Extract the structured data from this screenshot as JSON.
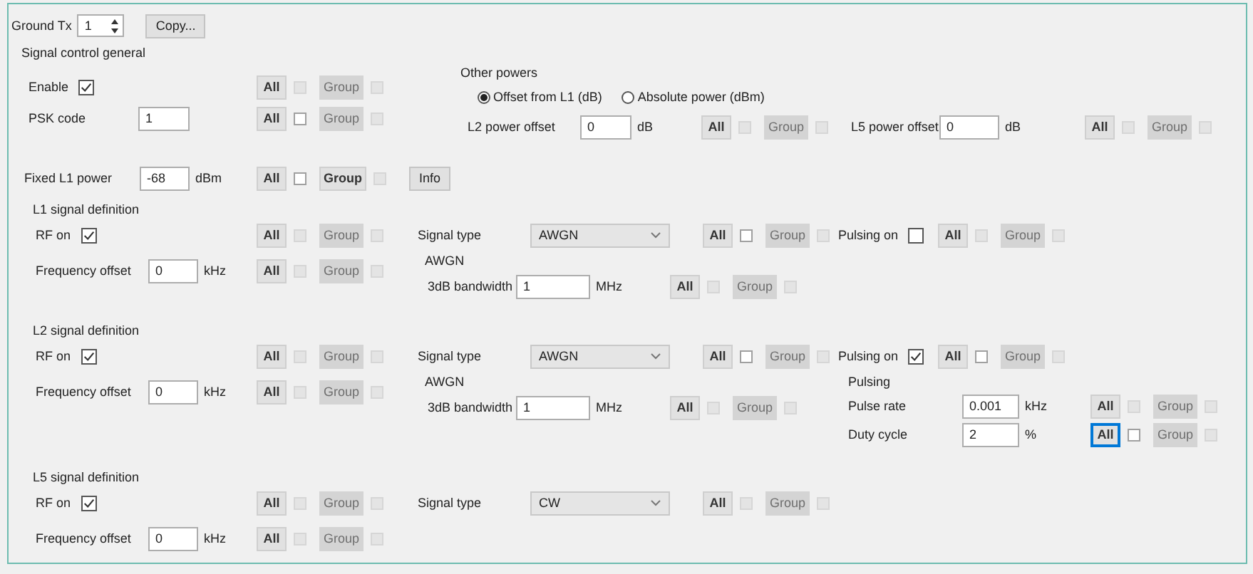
{
  "toolbar": {
    "label": "Ground Tx",
    "spin_value": "1",
    "copy_button": "Copy..."
  },
  "general": {
    "title": "Signal control general",
    "rows": [
      {
        "label": "Enable",
        "kind": "checkbox",
        "checked": true,
        "sync": [
          {
            "label": "All",
            "disabled": false,
            "focused": false,
            "box_disabled": true
          },
          {
            "label": "Group",
            "disabled": true,
            "focused": false,
            "box_disabled": true
          }
        ]
      },
      {
        "label": "PSK code",
        "kind": "field",
        "value": "1",
        "sync": [
          {
            "label": "All",
            "disabled": false,
            "focused": false,
            "box_disabled": false
          },
          {
            "label": "Group",
            "disabled": true,
            "focused": false,
            "box_disabled": true
          }
        ]
      }
    ],
    "other_powers": {
      "title": "Other powers",
      "options": [
        {
          "label": "Offset from L1 (dB)",
          "selected": true
        },
        {
          "label": "Absolute power (dBm)",
          "selected": false
        }
      ],
      "rows": [
        {
          "label": "L2 power offset",
          "kind": "field",
          "value": "0",
          "unit": "dB",
          "sync": [
            {
              "label": "All",
              "disabled": false,
              "focused": false,
              "box_disabled": true
            },
            {
              "label": "Group",
              "disabled": true,
              "focused": false,
              "box_disabled": true
            }
          ]
        },
        {
          "label": "L5 power offset",
          "kind": "field",
          "value": "0",
          "unit": "dB",
          "sync": [
            {
              "label": "All",
              "disabled": false,
              "focused": false,
              "box_disabled": true
            },
            {
              "label": "Group",
              "disabled": true,
              "focused": false,
              "box_disabled": true
            }
          ]
        }
      ]
    },
    "fixed_power": {
      "label": "Fixed L1 power",
      "kind": "field",
      "value": "-68",
      "unit": "dBm",
      "sync": [
        {
          "label": "All",
          "disabled": false,
          "focused": false,
          "box_disabled": false
        },
        {
          "label": "Group",
          "disabled": false,
          "focused": false,
          "box_disabled": true
        }
      ],
      "info_button": "Info"
    }
  },
  "signals": [
    {
      "title": "L1 signal definition",
      "rf": {
        "label": "RF on",
        "kind": "checkbox",
        "checked": true,
        "sync": [
          {
            "label": "All",
            "disabled": false,
            "focused": false,
            "box_disabled": true
          },
          {
            "label": "Group",
            "disabled": true,
            "focused": false,
            "box_disabled": true
          }
        ]
      },
      "frequency": {
        "label": "Frequency offset",
        "kind": "field",
        "value": "0",
        "unit": "kHz",
        "sync": [
          {
            "label": "All",
            "disabled": false,
            "focused": false,
            "box_disabled": true
          },
          {
            "label": "Group",
            "disabled": true,
            "focused": false,
            "box_disabled": true
          }
        ]
      },
      "signal_type": {
        "label": "Signal type",
        "kind": "dropdown",
        "value": "AWGN",
        "sync": [
          {
            "label": "All",
            "disabled": false,
            "focused": false,
            "box_disabled": false
          },
          {
            "label": "Group",
            "disabled": true,
            "focused": false,
            "box_disabled": true
          }
        ]
      },
      "awgn": {
        "title": "AWGN",
        "rows": [
          {
            "label": "3dB bandwidth",
            "kind": "field",
            "value": "1",
            "unit": "MHz",
            "sync": [
              {
                "label": "All",
                "disabled": false,
                "focused": false,
                "box_disabled": true
              },
              {
                "label": "Group",
                "disabled": true,
                "focused": false,
                "box_disabled": true
              }
            ]
          }
        ]
      },
      "pulsing": {
        "label": "Pulsing on",
        "kind": "checkbox",
        "checked": false,
        "sync": [
          {
            "label": "All",
            "disabled": false,
            "focused": false,
            "box_disabled": true
          },
          {
            "label": "Group",
            "disabled": true,
            "focused": false,
            "box_disabled": true
          }
        ]
      }
    },
    {
      "title": "L2 signal definition",
      "rf": {
        "label": "RF on",
        "kind": "checkbox",
        "checked": true,
        "sync": [
          {
            "label": "All",
            "disabled": false,
            "focused": false,
            "box_disabled": true
          },
          {
            "label": "Group",
            "disabled": true,
            "focused": false,
            "box_disabled": true
          }
        ]
      },
      "frequency": {
        "label": "Frequency offset",
        "kind": "field",
        "value": "0",
        "unit": "kHz",
        "sync": [
          {
            "label": "All",
            "disabled": false,
            "focused": false,
            "box_disabled": true
          },
          {
            "label": "Group",
            "disabled": true,
            "focused": false,
            "box_disabled": true
          }
        ]
      },
      "signal_type": {
        "label": "Signal type",
        "kind": "dropdown",
        "value": "AWGN",
        "sync": [
          {
            "label": "All",
            "disabled": false,
            "focused": false,
            "box_disabled": false
          },
          {
            "label": "Group",
            "disabled": true,
            "focused": false,
            "box_disabled": true
          }
        ]
      },
      "awgn": {
        "title": "AWGN",
        "rows": [
          {
            "label": "3dB bandwidth",
            "kind": "field",
            "value": "1",
            "unit": "MHz",
            "sync": [
              {
                "label": "All",
                "disabled": false,
                "focused": false,
                "box_disabled": true
              },
              {
                "label": "Group",
                "disabled": true,
                "focused": false,
                "box_disabled": true
              }
            ]
          }
        ]
      },
      "pulsing": {
        "label": "Pulsing on",
        "kind": "checkbox",
        "checked": true,
        "sync": [
          {
            "label": "All",
            "disabled": false,
            "focused": false,
            "box_disabled": false
          },
          {
            "label": "Group",
            "disabled": true,
            "focused": false,
            "box_disabled": true
          }
        ]
      },
      "pulse": {
        "title": "Pulsing",
        "rows": [
          {
            "label": "Pulse rate",
            "kind": "field",
            "value": "0.001",
            "unit": "kHz",
            "sync": [
              {
                "label": "All",
                "disabled": false,
                "focused": false,
                "box_disabled": true
              },
              {
                "label": "Group",
                "disabled": true,
                "focused": false,
                "box_disabled": true
              }
            ]
          },
          {
            "label": "Duty cycle",
            "kind": "field",
            "value": "2",
            "unit": "%",
            "sync": [
              {
                "label": "All",
                "disabled": false,
                "focused": true,
                "box_disabled": false
              },
              {
                "label": "Group",
                "disabled": true,
                "focused": false,
                "box_disabled": true
              }
            ]
          }
        ]
      }
    },
    {
      "title": "L5 signal definition",
      "rf": {
        "label": "RF on",
        "kind": "checkbox",
        "checked": true,
        "sync": [
          {
            "label": "All",
            "disabled": false,
            "focused": false,
            "box_disabled": true
          },
          {
            "label": "Group",
            "disabled": true,
            "focused": false,
            "box_disabled": true
          }
        ]
      },
      "frequency": {
        "label": "Frequency offset",
        "kind": "field",
        "value": "0",
        "unit": "kHz",
        "sync": [
          {
            "label": "All",
            "disabled": false,
            "focused": false,
            "box_disabled": true
          },
          {
            "label": "Group",
            "disabled": true,
            "focused": false,
            "box_disabled": true
          }
        ]
      },
      "signal_type": {
        "label": "Signal type",
        "kind": "dropdown",
        "value": "CW",
        "sync": [
          {
            "label": "All",
            "disabled": false,
            "focused": false,
            "box_disabled": true
          },
          {
            "label": "Group",
            "disabled": true,
            "focused": false,
            "box_disabled": true
          }
        ]
      }
    }
  ]
}
